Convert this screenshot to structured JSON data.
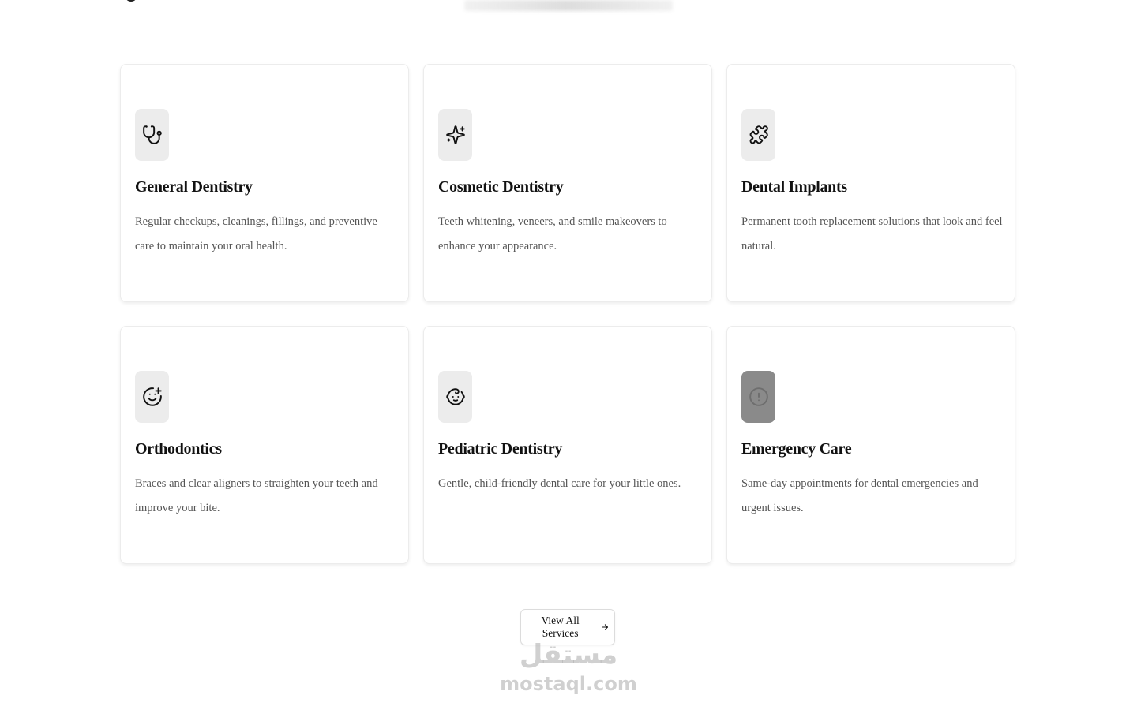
{
  "services": [
    {
      "title": "General Dentistry",
      "description": "Regular checkups, cleanings, fillings, and preventive care to maintain your oral health.",
      "icon": "stethoscope-icon"
    },
    {
      "title": "Cosmetic Dentistry",
      "description": "Teeth whitening, veneers, and smile makeovers to enhance your appearance.",
      "icon": "sparkles-icon"
    },
    {
      "title": "Dental Implants",
      "description": "Permanent tooth replacement solutions that look and feel natural.",
      "icon": "puzzle-icon"
    },
    {
      "title": "Orthodontics",
      "description": "Braces and clear aligners to straighten your teeth and improve your bite.",
      "icon": "smile-plus-icon"
    },
    {
      "title": "Pediatric Dentistry",
      "description": "Gentle, child-friendly dental care for your little ones.",
      "icon": "baby-icon"
    },
    {
      "title": "Emergency Care",
      "description": "Same-day appointments for dental emergencies and urgent issues.",
      "icon": "alert-circle-icon"
    }
  ],
  "cta": {
    "label": "View All Services",
    "icon": "arrow-right-icon"
  },
  "watermark": {
    "arabic": "مستقل",
    "latin": "mostaql.com"
  },
  "colors": {
    "icon_bg": "#ececec",
    "icon_bg_emergency": "#8a8a8a",
    "text": "#111111",
    "muted": "#555555"
  }
}
